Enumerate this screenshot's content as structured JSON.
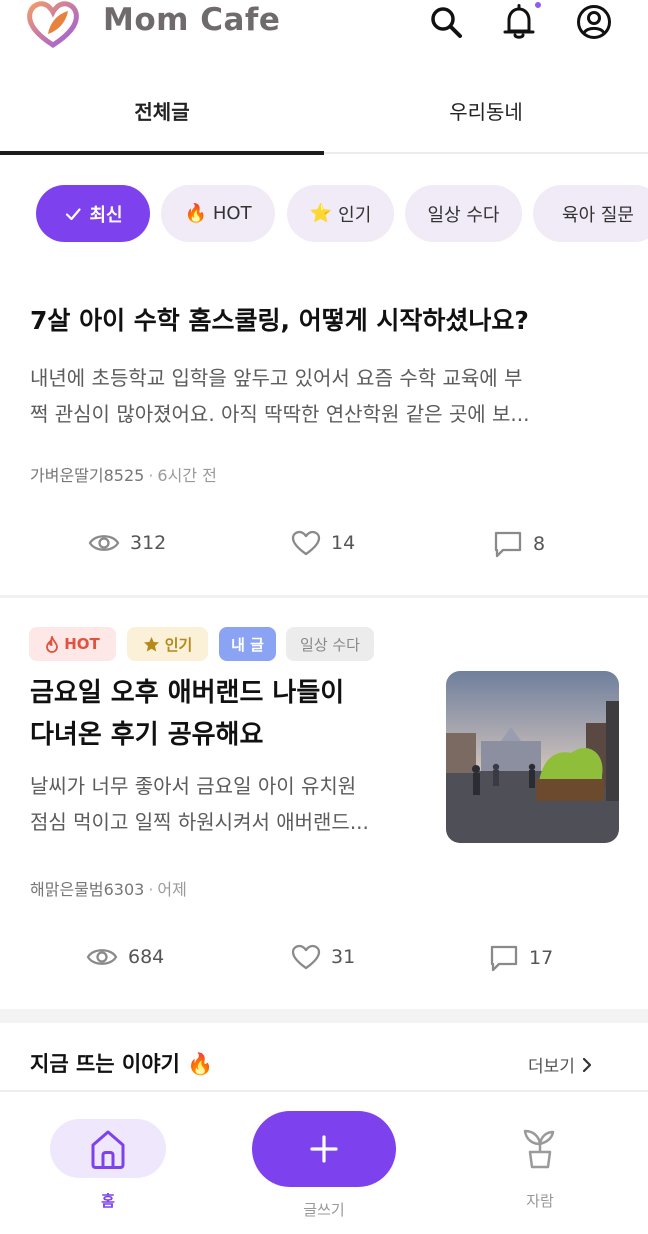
{
  "app": {
    "title": "Mom Cafe"
  },
  "header": {
    "search_icon": "search-icon",
    "bell_icon": "bell-icon",
    "profile_icon": "profile-icon",
    "has_notification": true
  },
  "tabs": [
    {
      "label": "전체글",
      "active": true
    },
    {
      "label": "우리동네",
      "active": false
    }
  ],
  "chips": [
    {
      "label": "최신",
      "icon": "check-icon",
      "active": true
    },
    {
      "label": "HOT",
      "icon": "🔥",
      "active": false
    },
    {
      "label": "인기",
      "icon": "⭐",
      "active": false
    },
    {
      "label": "일상 수다",
      "active": false
    },
    {
      "label": "육아 질문",
      "active": false
    }
  ],
  "posts": [
    {
      "title": "7살 아이 수학 홈스쿨링, 어떻게 시작하셨나요?",
      "excerpt_line1": "내년에 초등학교 입학을 앞두고 있어서 요즘 수학 교육에 부",
      "excerpt_line2": "쩍 관심이 많아졌어요. 아직 딱딱한 연산학원 같은 곳에 보...",
      "author": "가벼운딸기8525",
      "time": "6시간 전",
      "views": "312",
      "likes": "14",
      "comments": "8"
    },
    {
      "tags": {
        "hot": "HOT",
        "popular": "인기",
        "mine": "내 글",
        "category": "일상 수다"
      },
      "title_line1": "금요일 오후 애버랜드 나들이",
      "title_line2": "다녀온 후기 공유해요",
      "excerpt_line1": "날씨가 너무 좋아서 금요일 아이 유치원",
      "excerpt_line2": "점심 먹이고 일찍 하원시켜서 애버랜드...",
      "author": "해맑은물범6303",
      "time": "어제",
      "views": "684",
      "likes": "31",
      "comments": "17"
    }
  ],
  "trending": {
    "title": "지금 뜨는 이야기 🔥",
    "more": "더보기"
  },
  "bottom_nav": {
    "home": "홈",
    "write": "글쓰기",
    "grow": "자람"
  },
  "colors": {
    "accent": "#7d42ee",
    "hot": "#e0533f",
    "popular": "#b58a1a",
    "mine": "#8aa3f2"
  }
}
